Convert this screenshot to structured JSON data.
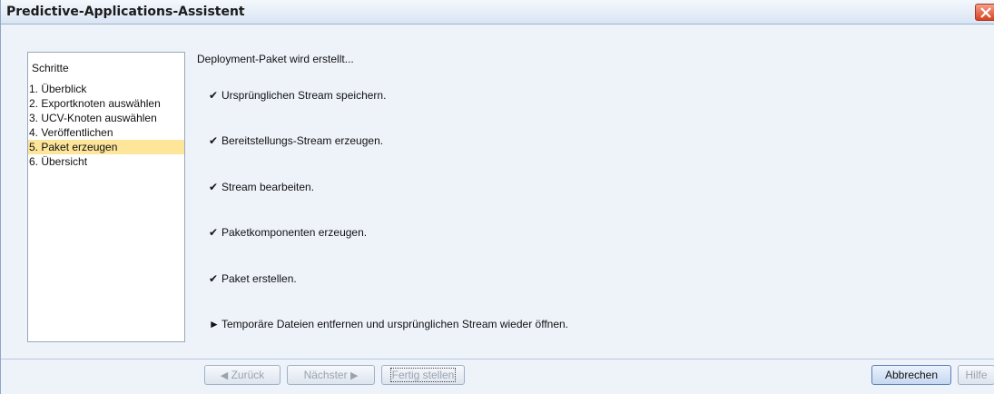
{
  "window": {
    "title": "Predictive-Applications-Assistent"
  },
  "sidebar": {
    "header": "Schritte",
    "items": [
      {
        "label": "1. Überblick"
      },
      {
        "label": "2. Exportknoten auswählen"
      },
      {
        "label": "3. UCV-Knoten auswählen"
      },
      {
        "label": "4. Veröffentlichen"
      },
      {
        "label": "5. Paket erzeugen",
        "selected": true
      },
      {
        "label": "6. Übersicht"
      }
    ]
  },
  "main": {
    "status": "Deployment-Paket wird erstellt...",
    "tasks": [
      {
        "mark": "✔",
        "label": "Ursprünglichen Stream speichern."
      },
      {
        "mark": "✔",
        "label": "Bereitstellungs-Stream erzeugen."
      },
      {
        "mark": "✔",
        "label": "Stream bearbeiten."
      },
      {
        "mark": "✔",
        "label": "Paketkomponenten erzeugen."
      },
      {
        "mark": "✔",
        "label": "Paket erstellen."
      },
      {
        "mark": "►",
        "label": "Temporäre Dateien entfernen und ursprünglichen Stream wieder öffnen."
      }
    ]
  },
  "buttons": {
    "back": "Zurück",
    "next": "Nächster",
    "finish": "Fertig stellen",
    "cancel": "Abbrechen",
    "help": "Hilfe"
  },
  "icons": {
    "close": "close-icon",
    "back": "arrow-left-icon",
    "next": "arrow-right-icon"
  }
}
